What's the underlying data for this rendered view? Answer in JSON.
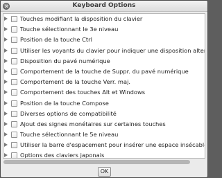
{
  "window": {
    "title": "Keyboard Options"
  },
  "options": [
    {
      "label": "Touches modifiant la disposition du clavier",
      "checked": false
    },
    {
      "label": "Touche sélectionnant le 3e niveau",
      "checked": false
    },
    {
      "label": "Position de la touche Ctrl",
      "checked": false
    },
    {
      "label": "Utiliser les voyants du clavier pour indiquer une disposition alternat",
      "checked": false
    },
    {
      "label": "Disposition du pavé numérique",
      "checked": false
    },
    {
      "label": "Comportement de la touche de Suppr. du pavé numérique",
      "checked": false
    },
    {
      "label": "Comportement de la touche Verr. maj.",
      "checked": false
    },
    {
      "label": "Comportement des touches Alt et Windows",
      "checked": false
    },
    {
      "label": "Position de la touche Compose",
      "checked": false
    },
    {
      "label": "Diverses options de compatibilité",
      "checked": false
    },
    {
      "label": "Ajout des signes monétaires sur certaines touches",
      "checked": false
    },
    {
      "label": "Touche sélectionnant le 5e niveau",
      "checked": false
    },
    {
      "label": "Utiliser la barre d'espacement pour insérer une espace insécable",
      "checked": false
    },
    {
      "label": "Options des claviers japonais",
      "checked": false
    }
  ],
  "buttons": {
    "ok_label": "OK"
  }
}
